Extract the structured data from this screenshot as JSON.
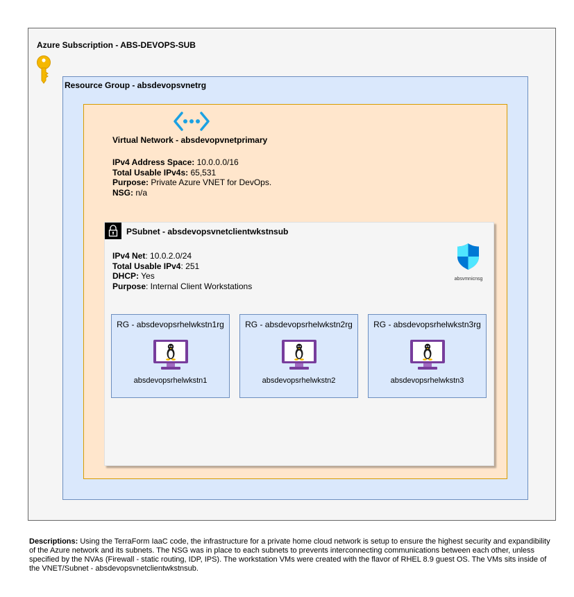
{
  "subscription": {
    "title": "Azure Subscription -  ABS-DEVOPS-SUB",
    "icon": "key-icon"
  },
  "resource_group": {
    "title": "Resource Group - absdevopsvnetrg"
  },
  "vnet": {
    "icon": "virtual-network-icon",
    "title": "Virtual Network - absdevopvnetprimary",
    "address_space_label": "IPv4 Address Space:",
    "address_space_value": " 10.0.0.0/16",
    "usable_label": "Total Usable IPv4s:",
    "usable_value": " 65,531",
    "purpose_label": "Purpose:",
    "purpose_value": " Private Azure VNET for DevOps.",
    "nsg_label": "NSG:",
    "nsg_value": " n/a"
  },
  "subnet": {
    "icon": "lock-icon",
    "title": "PSubnet - absdevopsvnetclientwkstnsub",
    "net_label": "IPv4 Net",
    "net_value": ": 10.0.2.0/24",
    "usable_label": "Total Usable IPv4",
    "usable_value": ": 251",
    "dhcp_label": "DHCP:",
    "dhcp_value": " Yes",
    "purpose_label": "Purpose",
    "purpose_value": ": Internal Client Workstations",
    "nsg": {
      "icon": "shield-icon",
      "label": "absvmnicnsg"
    }
  },
  "workstations": [
    {
      "rg": "RG - absdevopsrhelwkstn1rg",
      "vm": "absdevopsrhelwkstn1",
      "icon": "linux-vm-icon"
    },
    {
      "rg": "RG - absdevopsrhelwkstn2rg",
      "vm": "absdevopsrhelwkstn2",
      "icon": "linux-vm-icon"
    },
    {
      "rg": "RG - absdevopsrhelwkstn3rg",
      "vm": "absdevopsrhelwkstn3",
      "icon": "linux-vm-icon"
    }
  ],
  "colors": {
    "subscription_fill": "#f5f5f5",
    "resource_group_fill": "#dae8fc",
    "vnet_fill": "#ffe6cc",
    "vm_monitor": "#773d9c",
    "azure_blue": "#0ea5e9",
    "key_gold": "#f5b800"
  },
  "description": {
    "label": "Descriptions:",
    "text": " Using the TerraForm IaaC code, the infrastructure for a private home cloud network is setup to ensure the highest security and expandibility of the Azure network and its subnets. The NSG was in place to each subnets to prevents interconnecting communications between each other, unless specified by the NVAs (Firewall - static routing, IDP, IPS). The workstation VMs were created with the flavor of RHEL 8.9 guest OS. The VMs sits inside of the VNET/Subnet - absdevopsvnetclientwkstnsub."
  }
}
